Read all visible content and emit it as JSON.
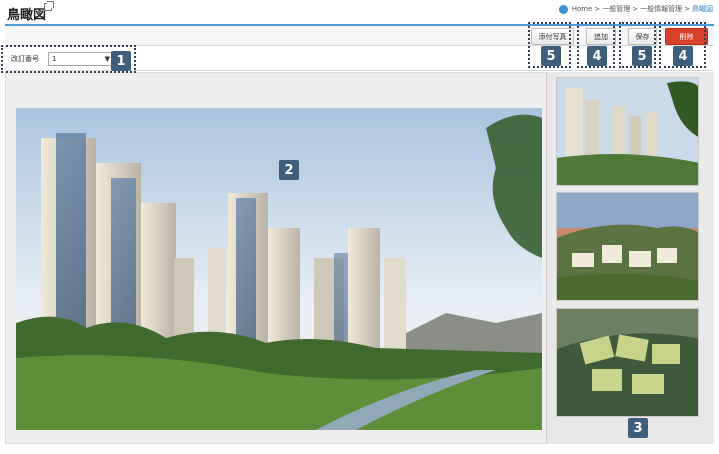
{
  "page": {
    "title": "鳥瞰図"
  },
  "breadcrumb": {
    "home": "Home",
    "sep": ">",
    "level1": "一般管理",
    "level2": "一般情報管理",
    "current": "鳥瞰図"
  },
  "toolbar": {
    "attach_photo_label": "添付写真",
    "add_label": "追加",
    "save_label": "保存",
    "delete_label": "削除"
  },
  "filter": {
    "revision_label": "改訂番号",
    "revision_value": "1"
  },
  "markers": {
    "m1": "1",
    "m2": "2",
    "m3": "3",
    "m4a": "4",
    "m4b": "4",
    "m5a": "5",
    "m5b": "5"
  },
  "colors": {
    "accent": "#4e9ad8",
    "delete": "#d7402a",
    "marker": "#3e5e7c"
  }
}
